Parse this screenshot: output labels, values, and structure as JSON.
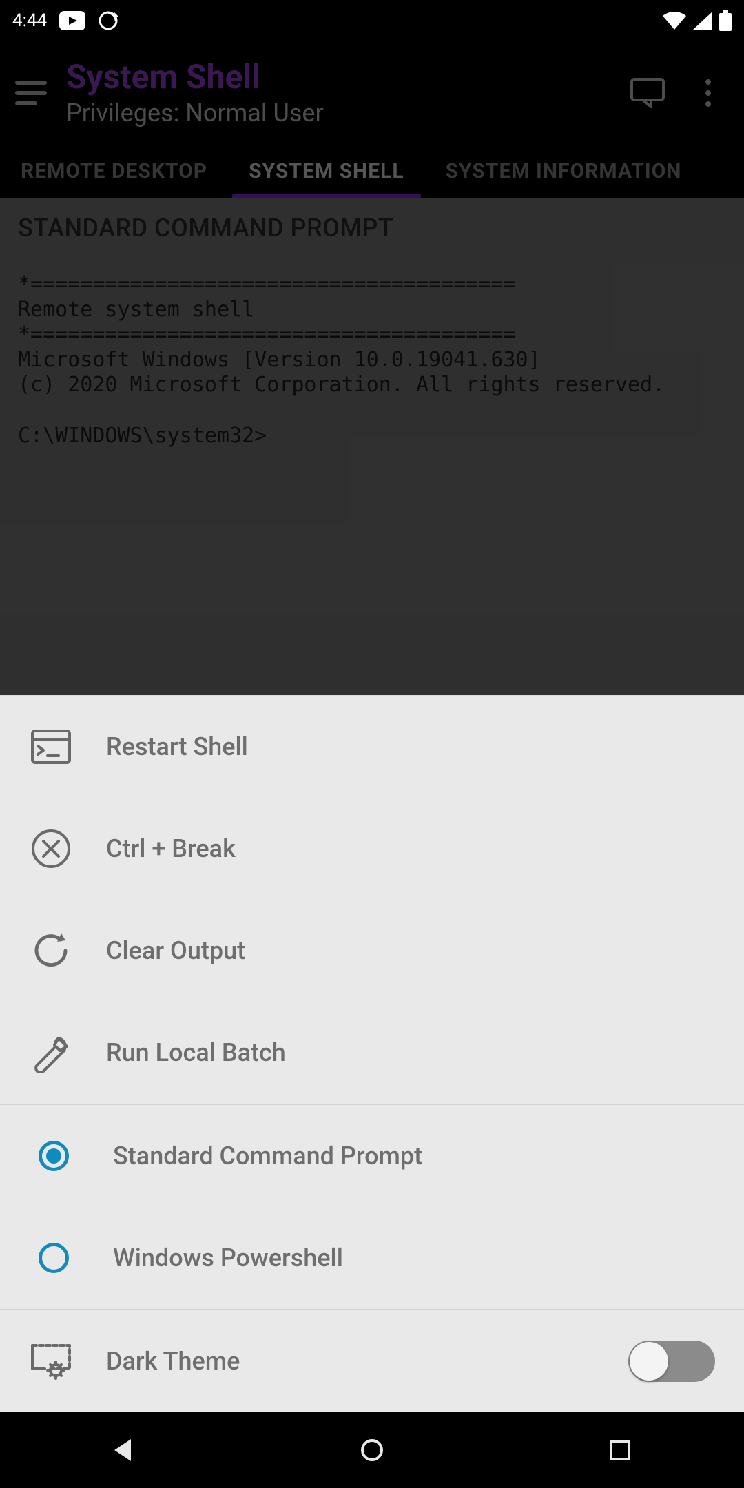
{
  "status": {
    "time": "4:44"
  },
  "header": {
    "title": "System Shell",
    "subtitle": "Privileges: Normal User"
  },
  "tabs": {
    "remote": "REMOTE DESKTOP",
    "shell": "SYSTEM SHELL",
    "info": "SYSTEM INFORMATION"
  },
  "section_header": "STANDARD COMMAND PROMPT",
  "terminal_text": "*=======================================\nRemote system shell\n*=======================================\nMicrosoft Windows [Version 10.0.19041.630]\n(c) 2020 Microsoft Corporation. All rights reserved.\n\nC:\\WINDOWS\\system32>",
  "menu": {
    "restart": "Restart Shell",
    "ctrlbreak": "Ctrl + Break",
    "clear": "Clear Output",
    "batch": "Run Local Batch",
    "cmd": "Standard Command Prompt",
    "ps": "Windows Powershell",
    "dark": "Dark Theme",
    "dark_enabled": false,
    "selected_shell": "cmd"
  },
  "colors": {
    "accent": "#8a2be2",
    "radio": "#0f8bbd"
  }
}
